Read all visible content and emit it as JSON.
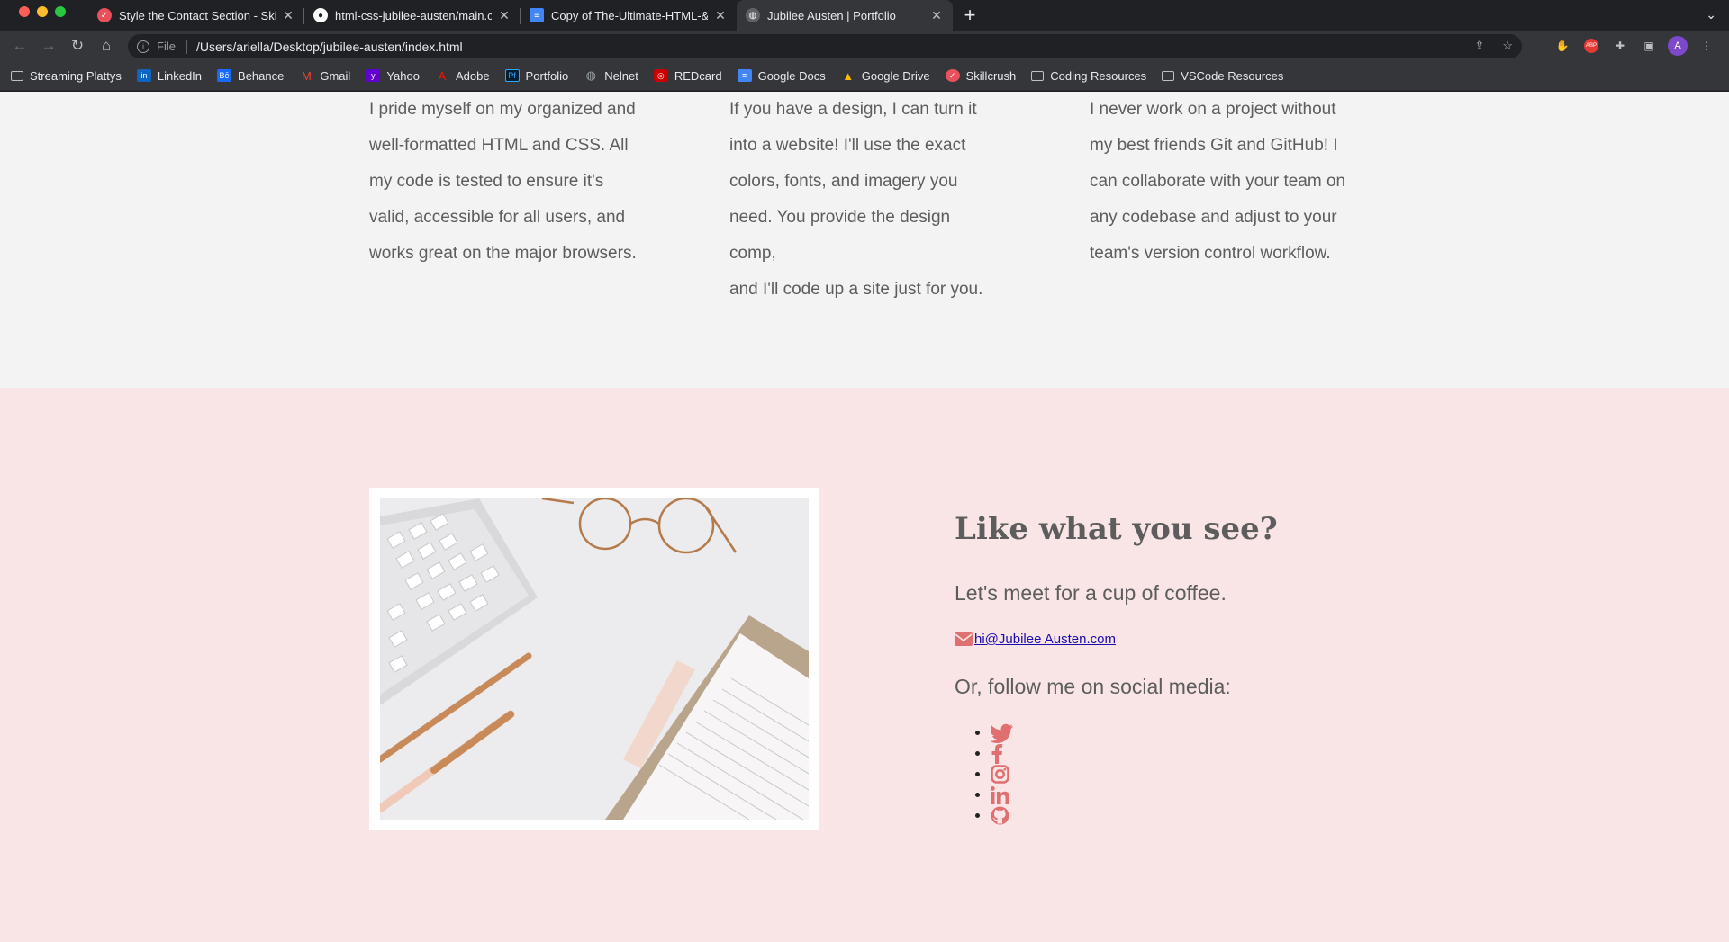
{
  "browser": {
    "tabs": [
      {
        "title": "Style the Contact Section - Skillcrush",
        "favicon_color": "#e8515b",
        "active": false
      },
      {
        "title": "html-css-jubilee-austen/main.css",
        "favicon_color": "#ffffff",
        "active": false
      },
      {
        "title": "Copy of The-Ultimate-HTML-&-CSS",
        "favicon_color": "#4285f4",
        "active": false
      },
      {
        "title": "Jubilee Austen | Portfolio",
        "favicon_color": "#5f6368",
        "active": true
      }
    ],
    "address": {
      "scheme": "File",
      "url": "/Users/ariella/Desktop/jubilee-austen/index.html"
    },
    "profile_initial": "A",
    "extensions": [
      "share-icon",
      "star-icon",
      "hand-icon",
      "abp-icon",
      "puzzle-icon",
      "sidebar-icon"
    ]
  },
  "bookmarks": [
    {
      "label": "Streaming Plattys",
      "icon": "folder-icon",
      "color": "#e8eaed"
    },
    {
      "label": "LinkedIn",
      "icon": "linkedin-icon",
      "color": "#0a66c2"
    },
    {
      "label": "Behance",
      "icon": "behance-icon",
      "color": "#1769ff"
    },
    {
      "label": "Gmail",
      "icon": "gmail-icon",
      "color": "#ea4335"
    },
    {
      "label": "Yahoo",
      "icon": "yahoo-icon",
      "color": "#6001d2"
    },
    {
      "label": "Adobe",
      "icon": "adobe-icon",
      "color": "#fa0f00"
    },
    {
      "label": "Portfolio",
      "icon": "portfolio-icon",
      "color": "#001e36"
    },
    {
      "label": "Nelnet",
      "icon": "globe-icon",
      "color": "#9aa0a6"
    },
    {
      "label": "REDcard",
      "icon": "target-icon",
      "color": "#cc0000"
    },
    {
      "label": "Google Docs",
      "icon": "docs-icon",
      "color": "#4285f4"
    },
    {
      "label": "Google Drive",
      "icon": "drive-icon",
      "color": "#34a853"
    },
    {
      "label": "Skillcrush",
      "icon": "skillcrush-icon",
      "color": "#e8515b"
    },
    {
      "label": "Coding Resources",
      "icon": "folder-icon",
      "color": "#e8eaed"
    },
    {
      "label": "VSCode Resources",
      "icon": "folder-icon",
      "color": "#e8eaed"
    }
  ],
  "skills": [
    {
      "lines": [
        "I pride myself on my organized and",
        "well-formatted HTML and CSS. All",
        "my code is tested to ensure it's",
        "valid, accessible for all users, and",
        "works great on the major browsers."
      ]
    },
    {
      "lines": [
        "If you have a design, I can turn it",
        "into a website! I'll use the exact",
        "colors, fonts, and imagery you",
        "need. You provide the design comp,",
        "and I'll code up a site just for you."
      ]
    },
    {
      "lines": [
        "I never work on a project without",
        "my best friends Git and GitHub! I",
        "can collaborate with your team on",
        "any codebase and adjust to your",
        "team's version control workflow."
      ]
    }
  ],
  "contact": {
    "title": "Like what you see?",
    "subtitle": "Let's meet for a cup of coffee.",
    "email": "hi@Jubilee Austen.com",
    "follow": "Or, follow me on social media:",
    "social": [
      "twitter-icon",
      "facebook-icon",
      "instagram-icon",
      "linkedin-icon",
      "github-icon"
    ],
    "accent": "#e07070",
    "background": "#f9e5e5"
  }
}
